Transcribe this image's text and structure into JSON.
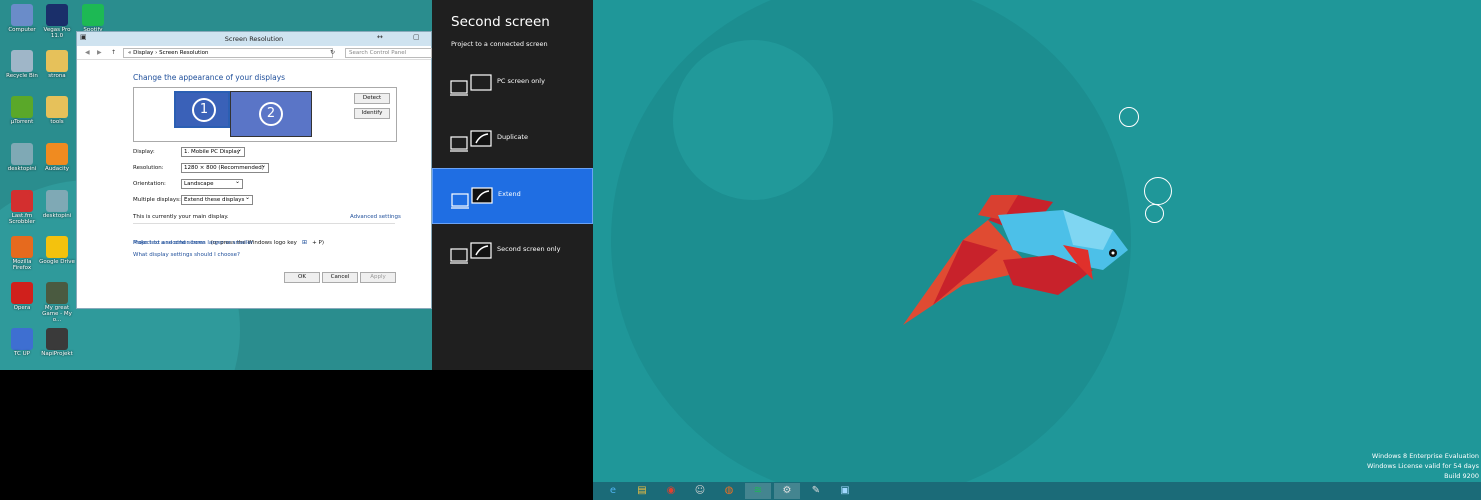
{
  "desktop_icons": [
    {
      "label": "Computer",
      "color": "#6a8cc9"
    },
    {
      "label": "Vegas Pro 11.0",
      "color": "#1a2f6a"
    },
    {
      "label": "Spotify",
      "color": "#1db954"
    },
    {
      "label": "Recycle Bin",
      "color": "#9fb6c8"
    },
    {
      "label": "strona",
      "color": "#e6c15a"
    },
    {
      "label": "µTorrent",
      "color": "#5aa829"
    },
    {
      "label": "tools",
      "color": "#e6c15a"
    },
    {
      "label": "desktopini",
      "color": "#7fa9b5"
    },
    {
      "label": "Audacity",
      "color": "#f08b20"
    },
    {
      "label": "Last.fm Scrobbler",
      "color": "#d32f2f"
    },
    {
      "label": "desktopini",
      "color": "#7fa9b5"
    },
    {
      "label": "Mozilla Firefox",
      "color": "#e66a1e"
    },
    {
      "label": "Google Drive",
      "color": "#f4c20d"
    },
    {
      "label": "Opera",
      "color": "#d0201c"
    },
    {
      "label": "My great Game - My o...",
      "color": "#4a5a40"
    },
    {
      "label": "TC UP",
      "color": "#3e6fd1"
    },
    {
      "label": "NapiProjekt",
      "color": "#3a3a3a"
    }
  ],
  "window": {
    "title": "Screen Resolution",
    "breadcrumb_root": "«",
    "breadcrumb_1": "Display",
    "breadcrumb_sep": "›",
    "breadcrumb_2": "Screen Resolution",
    "search_placeholder": "Search Control Panel",
    "heading": "Change the appearance of your displays",
    "monitor_1": "1",
    "monitor_2": "2",
    "detect_button": "Detect",
    "identify_button": "Identify",
    "display_label": "Display:",
    "display_value": "1. Mobile PC Display",
    "resolution_label": "Resolution:",
    "resolution_value": "1280 × 800 (Recommended)",
    "orientation_label": "Orientation:",
    "orientation_value": "Landscape",
    "multiple_label": "Multiple displays:",
    "multiple_value": "Extend these displays",
    "main_display_text": "This is currently your main display.",
    "advanced_link": "Advanced settings",
    "project_link": "Project to a second screen",
    "project_text": "(or press the Windows logo key",
    "project_text_end": "+ P)",
    "text_size_link": "Make text and other items larger or smaller",
    "which_link": "What display settings should I choose?",
    "ok_button": "OK",
    "cancel_button": "Cancel",
    "apply_button": "Apply",
    "minimize_glyph": "▭",
    "maximize_glyph": "▢",
    "restore_glyph": "↔"
  },
  "panel": {
    "title": "Second screen",
    "subtitle": "Project to a connected screen",
    "options": [
      {
        "label": "PC screen only",
        "selected": false
      },
      {
        "label": "Duplicate",
        "selected": false
      },
      {
        "label": "Extend",
        "selected": true
      },
      {
        "label": "Second screen only",
        "selected": false
      }
    ]
  },
  "watermark": {
    "line1": "Windows 8 Enterprise Evaluation",
    "line2": "Windows License valid for 54 days",
    "line3": "Build 9200"
  },
  "taskbar": [
    {
      "icon": "internet-explorer-icon",
      "glyph": "e",
      "color": "#4fb3f0"
    },
    {
      "icon": "file-explorer-icon",
      "glyph": "▤",
      "color": "#f0c040"
    },
    {
      "icon": "chrome-icon",
      "glyph": "◉",
      "color": "#e04030"
    },
    {
      "icon": "app-icon",
      "glyph": "☺",
      "color": "#d0d0d0"
    },
    {
      "icon": "firefox-icon",
      "glyph": "◍",
      "color": "#f07020"
    },
    {
      "icon": "spotify-icon",
      "glyph": "≋",
      "color": "#1db954"
    },
    {
      "icon": "network-icon",
      "glyph": "⚙",
      "color": "#e0e0e0"
    },
    {
      "icon": "settings-icon",
      "glyph": "✎",
      "color": "#e0e0e0"
    },
    {
      "icon": "display-icon",
      "glyph": "▣",
      "color": "#a0d8ff"
    }
  ],
  "colors": {
    "accent": "#1f6ee3",
    "desktop": "#1f9799",
    "panel": "#1f1f1f",
    "link": "#1e4e9a"
  }
}
